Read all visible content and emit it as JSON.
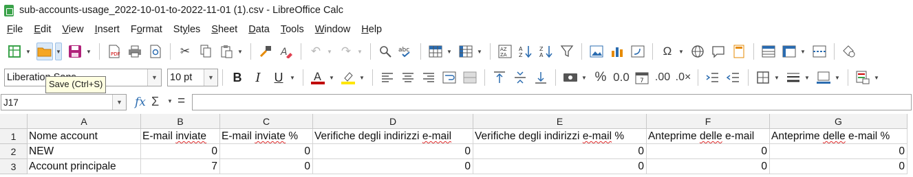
{
  "window": {
    "title": "sub-accounts-usage_2022-10-01-to-2022-11-01 (1).csv - LibreOffice Calc"
  },
  "menu": [
    {
      "prefix": "",
      "mnemonic": "F",
      "rest": "ile"
    },
    {
      "prefix": "",
      "mnemonic": "E",
      "rest": "dit"
    },
    {
      "prefix": "",
      "mnemonic": "V",
      "rest": "iew"
    },
    {
      "prefix": "",
      "mnemonic": "I",
      "rest": "nsert"
    },
    {
      "prefix": "F",
      "mnemonic": "o",
      "rest": "rmat"
    },
    {
      "prefix": "St",
      "mnemonic": "y",
      "rest": "les"
    },
    {
      "prefix": "",
      "mnemonic": "S",
      "rest": "heet"
    },
    {
      "prefix": "",
      "mnemonic": "D",
      "rest": "ata"
    },
    {
      "prefix": "",
      "mnemonic": "T",
      "rest": "ools"
    },
    {
      "prefix": "",
      "mnemonic": "W",
      "rest": "indow"
    },
    {
      "prefix": "",
      "mnemonic": "H",
      "rest": "elp"
    }
  ],
  "formatting": {
    "font_name": "Liberation Sans",
    "font_size": "10 pt"
  },
  "tooltip": "Save (Ctrl+S)",
  "formula_bar": {
    "cell_reference": "J17",
    "fx_symbol": "fx",
    "sigma_symbol": "Σ",
    "equals_symbol": "=",
    "formula": ""
  },
  "sheet": {
    "columns": [
      "A",
      "B",
      "C",
      "D",
      "E",
      "F",
      "G"
    ],
    "rows": [
      {
        "num": "1",
        "cells": [
          "Nome account",
          "E-mail inviate",
          "E-mail inviate %",
          "Verifiche degli indirizzi e-mail",
          "Verifiche degli indirizzi e-mail %",
          "Anteprime delle e-mail",
          "Anteprime delle e-mail %"
        ]
      },
      {
        "num": "2",
        "cells": [
          "NEW",
          "0",
          "0",
          "0",
          "0",
          "0",
          "0"
        ]
      },
      {
        "num": "3",
        "cells": [
          " Account  principale",
          "7",
          "0",
          "0",
          "0",
          "0",
          "0"
        ]
      }
    ]
  },
  "colors": {
    "accent": "#2b6cb0",
    "font_color_bar": "#c00000",
    "highlight_bar": "#ffe600",
    "spreadsheet_icon": "#3aa24a"
  }
}
